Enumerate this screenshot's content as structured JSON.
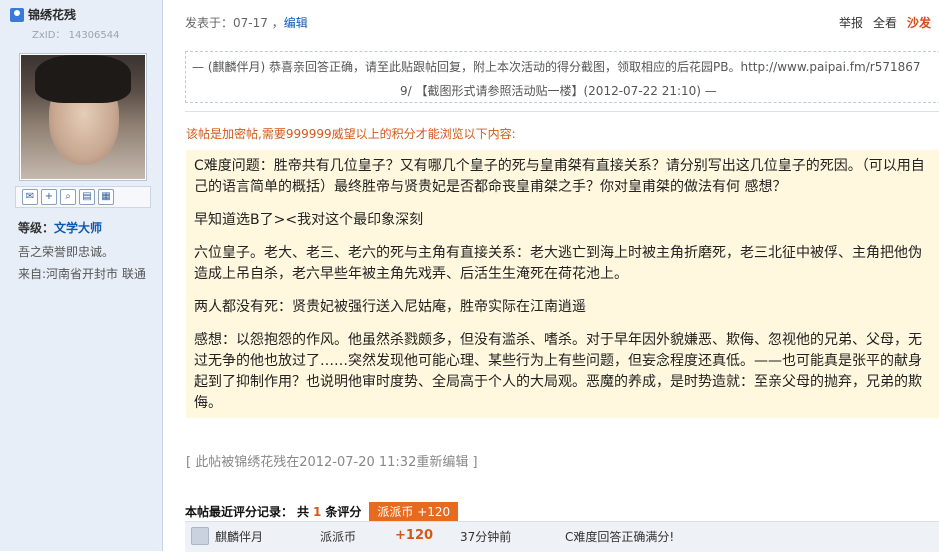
{
  "sidebar": {
    "username": "锦绣花残",
    "zxid": "ZxID： 14306544",
    "level_label": "等级：",
    "level_value": "文学大师",
    "motto": "吾之荣誉即忠诚。",
    "origin": "来自:河南省开封市 联通",
    "icons": [
      "mail-icon",
      "add-friend-icon",
      "search-icon",
      "profile-icon",
      "blocks-icon"
    ]
  },
  "post": {
    "posted_at": "发表于：07-17",
    "edit_link": "编辑",
    "actions": [
      "举报",
      "全看",
      "沙发"
    ],
    "quote_line1": "— (麒麟伴月) 恭喜亲回答正确，请至此贴跟帖回复，附上本次活动的得分截图，领取相应的后花园PB。http://www.paipai.fm/r571867",
    "quote_line2": "9/ 【截图形式请参照活动贴一楼】(2012-07-22 21:10) —",
    "encrypted_notice": "该帖是加密帖,需要999999威望以上的积分才能浏览以下内容:",
    "content": [
      "C难度问题：胜帝共有几位皇子？又有哪几个皇子的死与皇甫桀有直接关系？请分别写出这几位皇子的死因。（可以用自己的语言简单的概括）最终胜帝与贤贵妃是否都命丧皇甫桀之手？你对皇甫桀的做法有何 感想？",
      "早知道选B了><我对这个最印象深刻",
      "六位皇子。老大、老三、老六的死与主角有直接关系：老大逃亡到海上时被主角折磨死，老三北征中被俘、主角把他伪造成上吊自杀，老六早些年被主角先戏弄、后活生生淹死在荷花池上。",
      "两人都没有死：贤贵妃被强行送入尼姑庵，胜帝实际在江南逍遥",
      "感想：以怨抱怨的作风。他虽然杀戮颇多，但没有滥杀、嗜杀。对于早年因外貌嫌恶、欺侮、忽视他的兄弟、父母，无过无争的他也放过了……突然发现他可能心理、某些行为上有些问题，但妄念程度还真低。——也可能真是张平的献身起到了抑制作用？也说明他审时度势、全局高于个人的大局观。恶魔的养成，是时势造就：至亲父母的抛弃，兄弟的欺侮。"
    ],
    "edited_note": "[ 此帖被锦绣花残在2012-07-20 11:32重新编辑 ]"
  },
  "rating": {
    "title": "本帖最近评分记录：",
    "prefix": "共",
    "count": "1",
    "suffix": "条评分",
    "badge": "派派币 +120",
    "row": {
      "user": "麒麟伴月",
      "currency": "派派币",
      "score": "+120",
      "time": "37分钟前",
      "reason": "C难度回答正确满分!"
    }
  }
}
